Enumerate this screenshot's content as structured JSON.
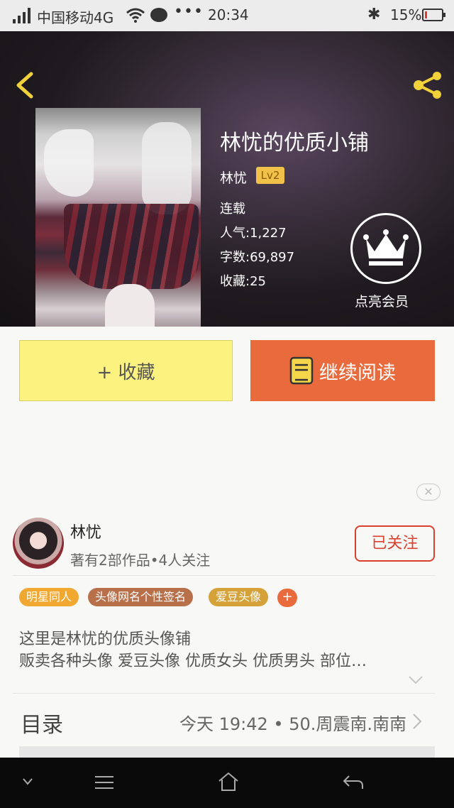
{
  "status_bar": {
    "carrier": "中国移动4G",
    "dots": "•••",
    "time": "20:34",
    "battery": "15%",
    "battery_level": 0.15
  },
  "book": {
    "title": "林忧的优质小铺",
    "author": "林忧",
    "level": "Lv2",
    "status": "连载",
    "popularity_label": "人气:",
    "popularity": "1,227",
    "words_label": "字数:",
    "words": "69,897",
    "favorites_label": "收藏:",
    "favorites": "25",
    "vip_label": "点亮会员"
  },
  "actions": {
    "favorite": "+ 收藏",
    "continue_reading": "继续阅读"
  },
  "ad_close": "✕",
  "author_card": {
    "name": "林忧",
    "stats": "著有2部作品•4人关注",
    "follow_button": "已关注"
  },
  "tags": [
    {
      "label": "明星同人",
      "color": "#f0a830"
    },
    {
      "label": "头像网名个性签名",
      "color": "#b8704a"
    },
    {
      "label": "爱豆头像",
      "color": "#d5a23a"
    }
  ],
  "tag_add": "+",
  "description": {
    "line1": "这里是林忧的优质头像铺",
    "line2": "贩卖各种头像  爱豆头像  优质女头  优质男头  部位…"
  },
  "catalog": {
    "label": "目录",
    "latest": "今天 19:42 • 50.周震南.南南"
  },
  "colors": {
    "accent_orange": "#e96a3c",
    "favorite_yellow": "#fbf280",
    "follow_red": "#d9402e"
  }
}
